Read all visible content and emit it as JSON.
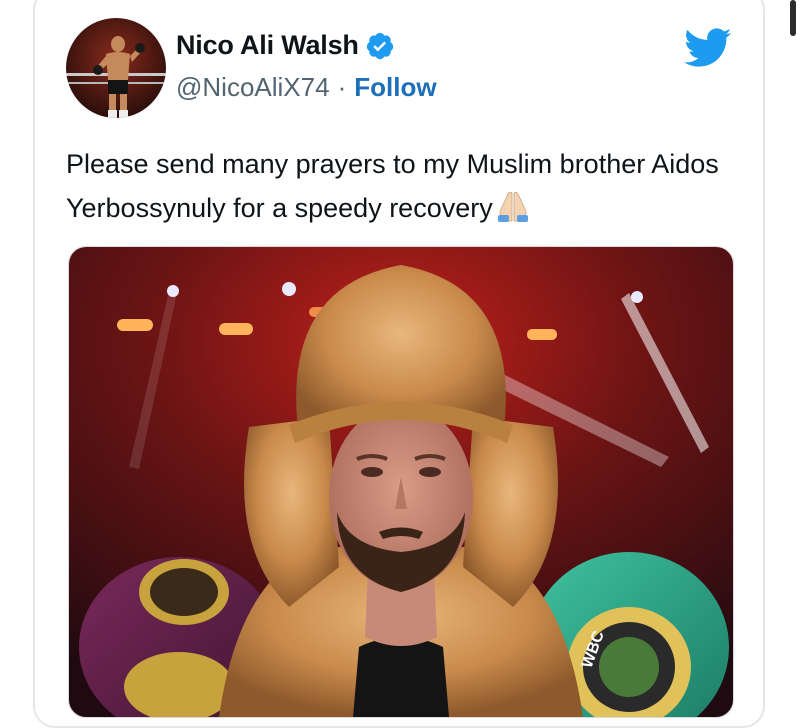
{
  "tweet": {
    "author_name": "Nico Ali Walsh",
    "handle": "@NicoAliX74",
    "separator": "·",
    "follow_label": "Follow",
    "text": "Please send many prayers to my Muslim brother Aidos Yerbossynuly for a speedy recovery",
    "emoji": "folded-hands-icon"
  },
  "media": {
    "belt_left_text": "",
    "belt_right_text": "WBC"
  },
  "colors": {
    "twitter_blue": "#1d9bf0",
    "follow_blue": "#1d6fb8",
    "text": "#0f1419",
    "muted": "#536471"
  }
}
